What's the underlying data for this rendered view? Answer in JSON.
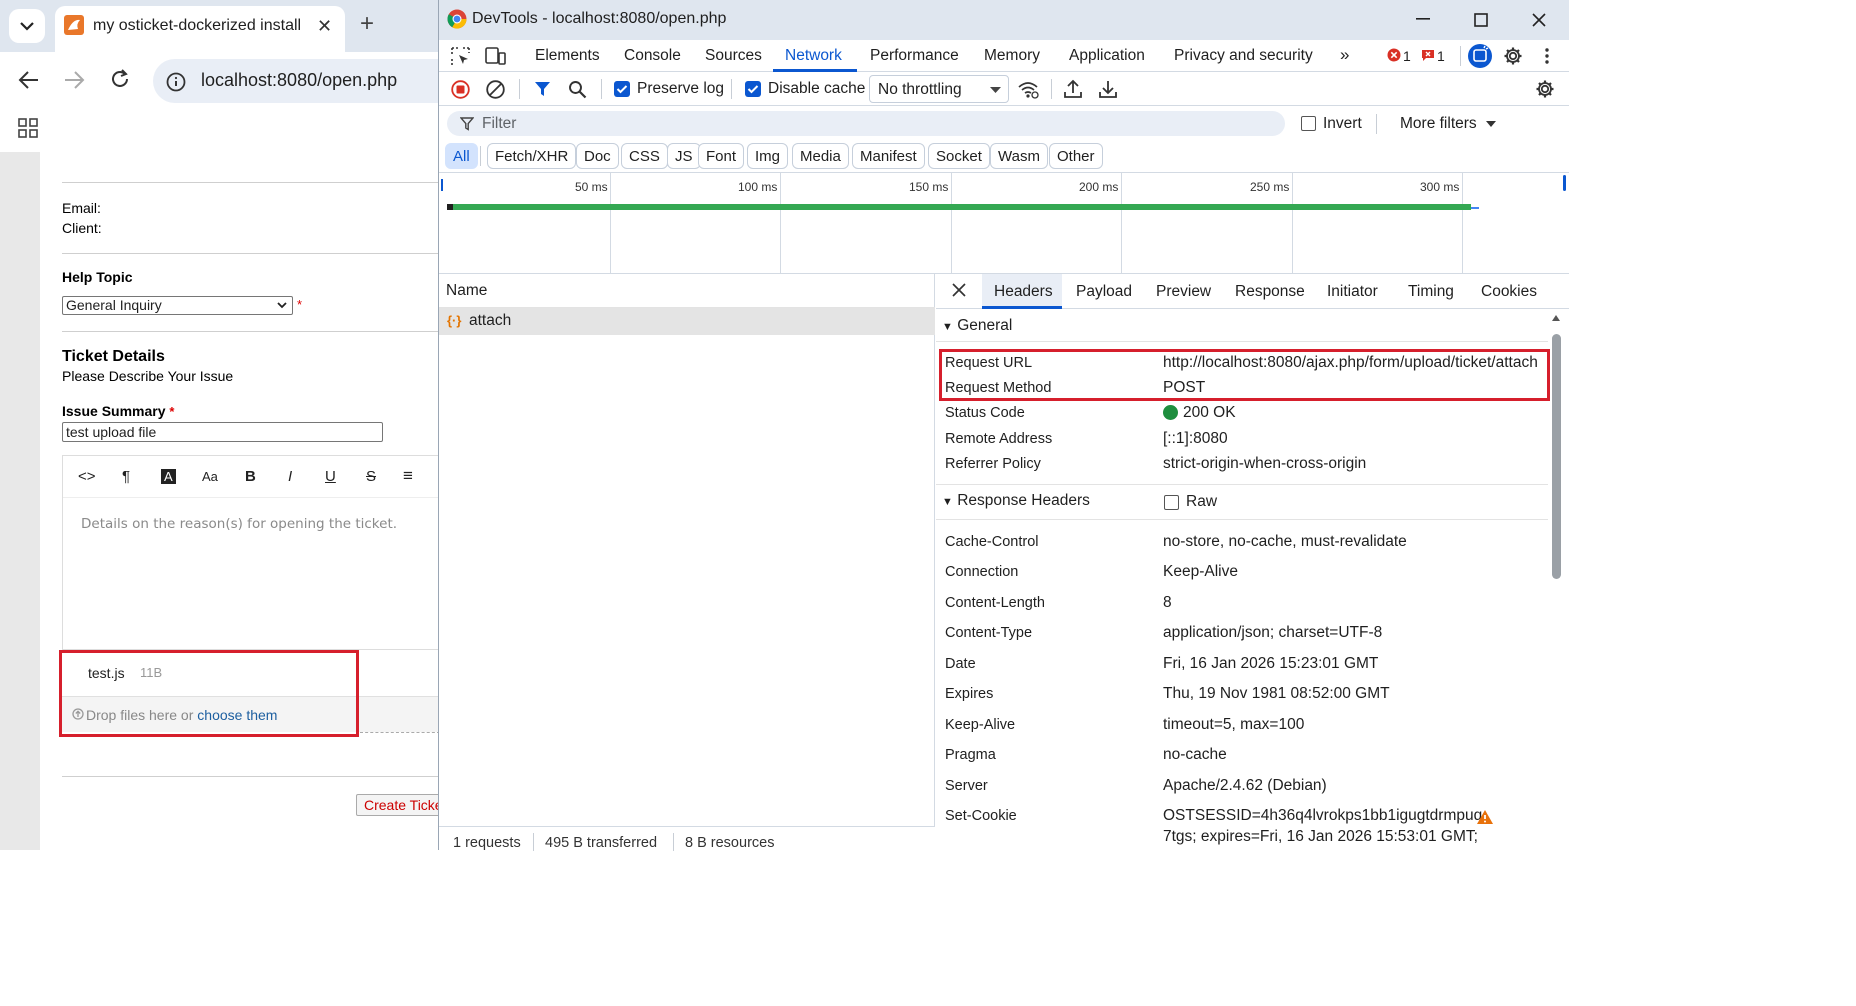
{
  "browser": {
    "tab_title": "my osticket-dockerized install",
    "url": "localhost:8080/open.php"
  },
  "form": {
    "email_label": "Email:",
    "client_label": "Client:",
    "help_topic_label": "Help Topic",
    "help_topic_value": "General Inquiry",
    "required_mark": "*",
    "ticket_details_title": "Ticket Details",
    "ticket_details_sub": "Please Describe Your Issue",
    "issue_summary_label": "Issue Summary",
    "issue_summary_value": "test upload file",
    "editor_placeholder": "Details on the reason(s) for opening the ticket.",
    "editor_tools": [
      "<>",
      "¶",
      "A",
      "Aa",
      "B",
      "I",
      "U",
      "S",
      "≡"
    ],
    "attachment_name": "test.js",
    "attachment_size": "11B",
    "drop_text": "Drop files here or ",
    "drop_link": "choose them",
    "create_button": "Create Ticket"
  },
  "devtools": {
    "title": "DevTools - localhost:8080/open.php",
    "tabs": [
      "Elements",
      "Console",
      "Sources",
      "Network",
      "Performance",
      "Memory",
      "Application",
      "Privacy and security"
    ],
    "active_tab": "Network",
    "error_count": "1",
    "issue_count": "1",
    "preserve_log": "Preserve log",
    "disable_cache": "Disable cache",
    "throttling": "No throttling",
    "filter_placeholder": "Filter",
    "invert": "Invert",
    "more_filters": "More filters",
    "type_filters": [
      "All",
      "Fetch/XHR",
      "Doc",
      "CSS",
      "JS",
      "Font",
      "Img",
      "Media",
      "Manifest",
      "Socket",
      "Wasm",
      "Other"
    ],
    "timeline_labels": [
      "50 ms",
      "100 ms",
      "150 ms",
      "200 ms",
      "250 ms",
      "300 ms"
    ],
    "name_header": "Name",
    "request_name": "attach",
    "request_icon": "{·}",
    "detail_tabs": [
      "Headers",
      "Payload",
      "Preview",
      "Response",
      "Initiator",
      "Timing",
      "Cookies"
    ],
    "general_section": "General",
    "general": [
      {
        "key": "Request URL",
        "value": "http://localhost:8080/ajax.php/form/upload/ticket/attach"
      },
      {
        "key": "Request Method",
        "value": "POST"
      },
      {
        "key": "Status Code",
        "value": "200 OK"
      },
      {
        "key": "Remote Address",
        "value": "[::1]:8080"
      },
      {
        "key": "Referrer Policy",
        "value": "strict-origin-when-cross-origin"
      }
    ],
    "response_section": "Response Headers",
    "raw_label": "Raw",
    "response_headers": [
      {
        "key": "Cache-Control",
        "value": "no-store, no-cache, must-revalidate"
      },
      {
        "key": "Connection",
        "value": "Keep-Alive"
      },
      {
        "key": "Content-Length",
        "value": "8"
      },
      {
        "key": "Content-Type",
        "value": "application/json; charset=UTF-8"
      },
      {
        "key": "Date",
        "value": "Fri, 16 Jan 2026 15:23:01 GMT"
      },
      {
        "key": "Expires",
        "value": "Thu, 19 Nov 1981 08:52:00 GMT"
      },
      {
        "key": "Keep-Alive",
        "value": "timeout=5, max=100"
      },
      {
        "key": "Pragma",
        "value": "no-cache"
      },
      {
        "key": "Server",
        "value": "Apache/2.4.62 (Debian)"
      },
      {
        "key": "Set-Cookie",
        "value": "OSTSESSID=4h36q4lvrokps1bb1igugtdrmpuq"
      }
    ],
    "set_cookie_cont": "7tgs; expires=Fri, 16 Jan 2026 15:53:01 GMT;",
    "status_requests": "1 requests",
    "status_transferred": "495 B transferred",
    "status_resources": "8 B resources"
  },
  "colors": {
    "accent": "#0b57d0",
    "highlight_box": "#d61f2c",
    "status_ok": "#1e8e3e",
    "timeline_bar": "#34a853"
  }
}
